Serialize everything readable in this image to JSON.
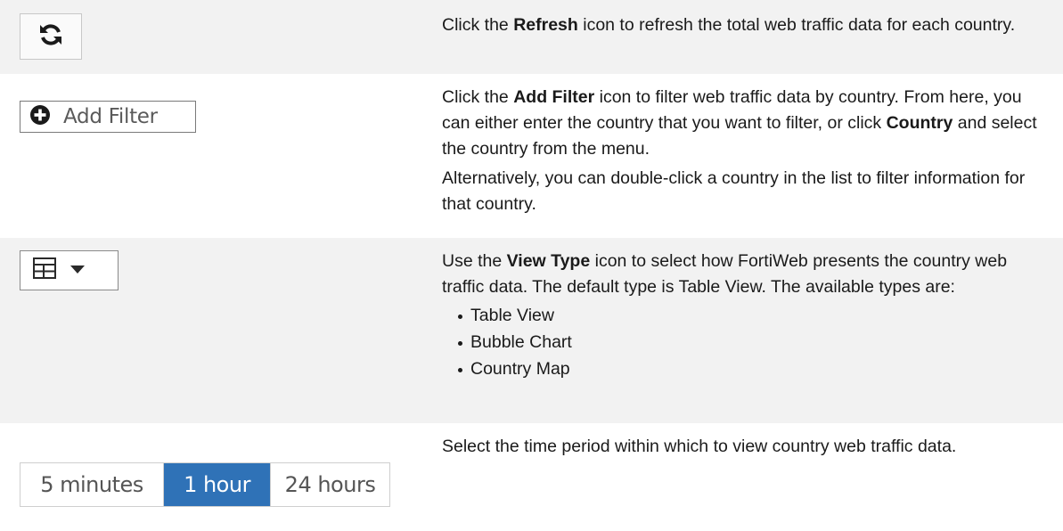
{
  "rows": [
    {
      "control": {
        "icon": "refresh-icon"
      },
      "desc": {
        "pre": "Click the ",
        "bold": "Refresh",
        "post": " icon to refresh the total web traffic data for each country."
      }
    },
    {
      "control": {
        "icon": "plus-circle-icon",
        "label": "Add Filter"
      },
      "desc": {
        "pre": "Click the ",
        "bold": "Add Filter",
        "mid": " icon to filter web traffic data by country. From here, you can either enter the country that you want to filter, or click ",
        "bold2": "Country",
        "post": " and select the country from the menu.",
        "p2": "Alternatively, you can double-click a country in the list to filter information for that country."
      }
    },
    {
      "control": {
        "icon": "table-icon",
        "caret": "caret-down-icon"
      },
      "desc": {
        "pre": "Use the ",
        "bold": "View Type",
        "post": " icon to select how FortiWeb presents the country web traffic data. The default type is Table View. The available types are:",
        "items": [
          "Table View",
          "Bubble Chart",
          "Country Map"
        ]
      }
    },
    {
      "control": {
        "options": [
          "5 minutes",
          "1 hour",
          "24 hours"
        ],
        "selected": "1 hour"
      },
      "desc": {
        "text": "Select the time period within which to view country web traffic data."
      }
    }
  ],
  "colors": {
    "selected": "#2f72b7",
    "row_shade": "#f2f2f2"
  }
}
